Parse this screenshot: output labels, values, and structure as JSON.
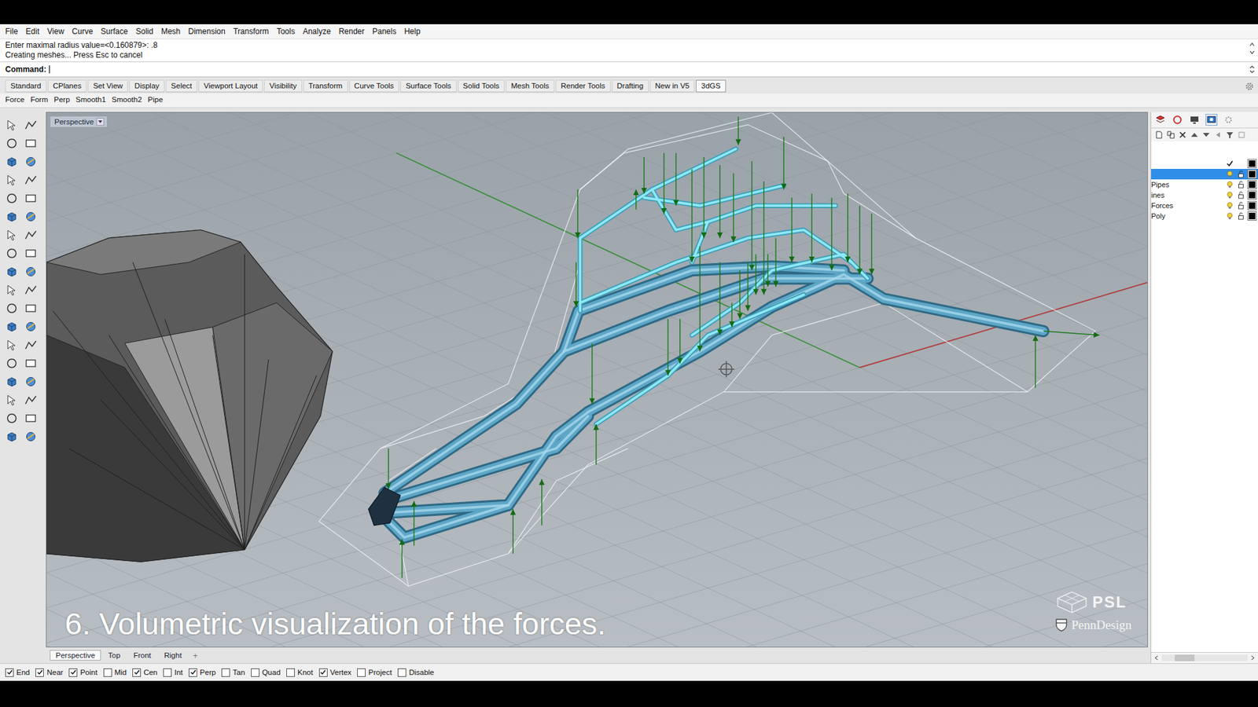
{
  "menu": [
    "File",
    "Edit",
    "View",
    "Curve",
    "Surface",
    "Solid",
    "Mesh",
    "Dimension",
    "Transform",
    "Tools",
    "Analyze",
    "Render",
    "Panels",
    "Help"
  ],
  "command_history": [
    "Enter maximal radius value=<0.160879>: .8",
    "Creating meshes... Press Esc to cancel"
  ],
  "command_prompt": "Command:",
  "toolbar_tabs": [
    {
      "label": "Standard",
      "selected": false
    },
    {
      "label": "CPlanes",
      "selected": false
    },
    {
      "label": "Set View",
      "selected": false
    },
    {
      "label": "Display",
      "selected": false
    },
    {
      "label": "Select",
      "selected": false
    },
    {
      "label": "Viewport Layout",
      "selected": false
    },
    {
      "label": "Visibility",
      "selected": false
    },
    {
      "label": "Transform",
      "selected": false
    },
    {
      "label": "Curve Tools",
      "selected": false
    },
    {
      "label": "Surface Tools",
      "selected": false
    },
    {
      "label": "Solid Tools",
      "selected": false
    },
    {
      "label": "Mesh Tools",
      "selected": false
    },
    {
      "label": "Render Tools",
      "selected": false
    },
    {
      "label": "Drafting",
      "selected": false
    },
    {
      "label": "New in V5",
      "selected": false
    },
    {
      "label": "3dGS",
      "selected": true
    }
  ],
  "plugin_commands": [
    "Force",
    "Form",
    "Perp",
    "Smooth1",
    "Smooth2",
    "Pipe"
  ],
  "viewport": {
    "label": "Perspective",
    "caption": "6. Volumetric visualization of the forces.",
    "logos": [
      "PSL",
      "PennDesign"
    ]
  },
  "viewport_tabs": [
    {
      "label": "Perspective",
      "selected": true
    },
    {
      "label": "Top",
      "selected": false
    },
    {
      "label": "Front",
      "selected": false
    },
    {
      "label": "Right",
      "selected": false
    }
  ],
  "add_viewport_tab": "+",
  "layers": [
    {
      "name": "",
      "current": true,
      "selected": false,
      "on": true,
      "locked": false
    },
    {
      "name": "",
      "current": false,
      "selected": true,
      "on": true,
      "locked": false
    },
    {
      "name": "Pipes",
      "current": false,
      "selected": false,
      "on": true,
      "locked": false
    },
    {
      "name": "ines",
      "current": false,
      "selected": false,
      "on": true,
      "locked": false
    },
    {
      "name": "Forces",
      "current": false,
      "selected": false,
      "on": true,
      "locked": false
    },
    {
      "name": "Poly",
      "current": false,
      "selected": false,
      "on": true,
      "locked": false
    }
  ],
  "osnaps": [
    {
      "label": "End",
      "checked": true
    },
    {
      "label": "Near",
      "checked": true
    },
    {
      "label": "Point",
      "checked": true
    },
    {
      "label": "Mid",
      "checked": false
    },
    {
      "label": "Cen",
      "checked": true
    },
    {
      "label": "Int",
      "checked": false
    },
    {
      "label": "Perp",
      "checked": true
    },
    {
      "label": "Tan",
      "checked": false
    },
    {
      "label": "Quad",
      "checked": false
    },
    {
      "label": "Knot",
      "checked": false
    },
    {
      "label": "Vertex",
      "checked": true
    },
    {
      "label": "Project",
      "checked": false
    },
    {
      "label": "Disable",
      "checked": false
    }
  ]
}
